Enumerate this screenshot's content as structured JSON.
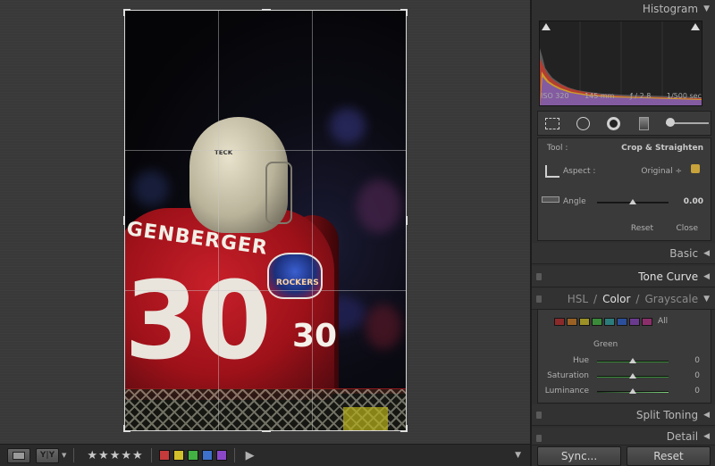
{
  "panels": {
    "histogram": {
      "title": "Histogram"
    },
    "histo_info": {
      "iso": "ISO 320",
      "focal": "145 mm",
      "aperture": "ƒ / 2.8",
      "shutter": "1/500 sec"
    },
    "crop": {
      "tool_label": "Tool :",
      "tool_value": "Crop & Straighten",
      "aspect_label": "Aspect :",
      "aspect_value": "Original ÷",
      "angle_label": "Angle",
      "angle_value": "0.00",
      "angle_level": 0.5,
      "reset": "Reset",
      "close": "Close"
    },
    "basic": "Basic",
    "tone_curve": "Tone Curve",
    "hsl": {
      "hsl": "HSL",
      "slash": "/",
      "color": "Color",
      "grayscale": "Grayscale",
      "all": "All"
    },
    "color_panel": {
      "selected": "Green",
      "hue_label": "Hue",
      "hue_value": "0",
      "sat_label": "Saturation",
      "sat_value": "0",
      "lum_label": "Luminance",
      "lum_value": "0"
    },
    "split_toning": "Split Toning",
    "detail": "Detail",
    "sync": "Sync...",
    "reset_btn": "Reset"
  },
  "photo": {
    "jersey_name": "GENBERGER",
    "jersey_number_back": "30",
    "jersey_number_arm": "30",
    "helmet_brand": "TECK",
    "logo_text": "ROCKERS"
  },
  "toolbar": {
    "stars": "★★★★★",
    "yy_label": "Y|Y",
    "colors": [
      "#c53a3a",
      "#d2c12a",
      "#43b043",
      "#3d71cc",
      "#8a48c9"
    ]
  },
  "hsl_chips": [
    "#8b2a2a",
    "#9a6124",
    "#9c9126",
    "#3a8a3a",
    "#2d7c7c",
    "#2b4f9a",
    "#6a3a8e",
    "#8b2f6b"
  ],
  "accent": {
    "red": "#c8202a",
    "panel_bg": "#2f2f2f"
  }
}
